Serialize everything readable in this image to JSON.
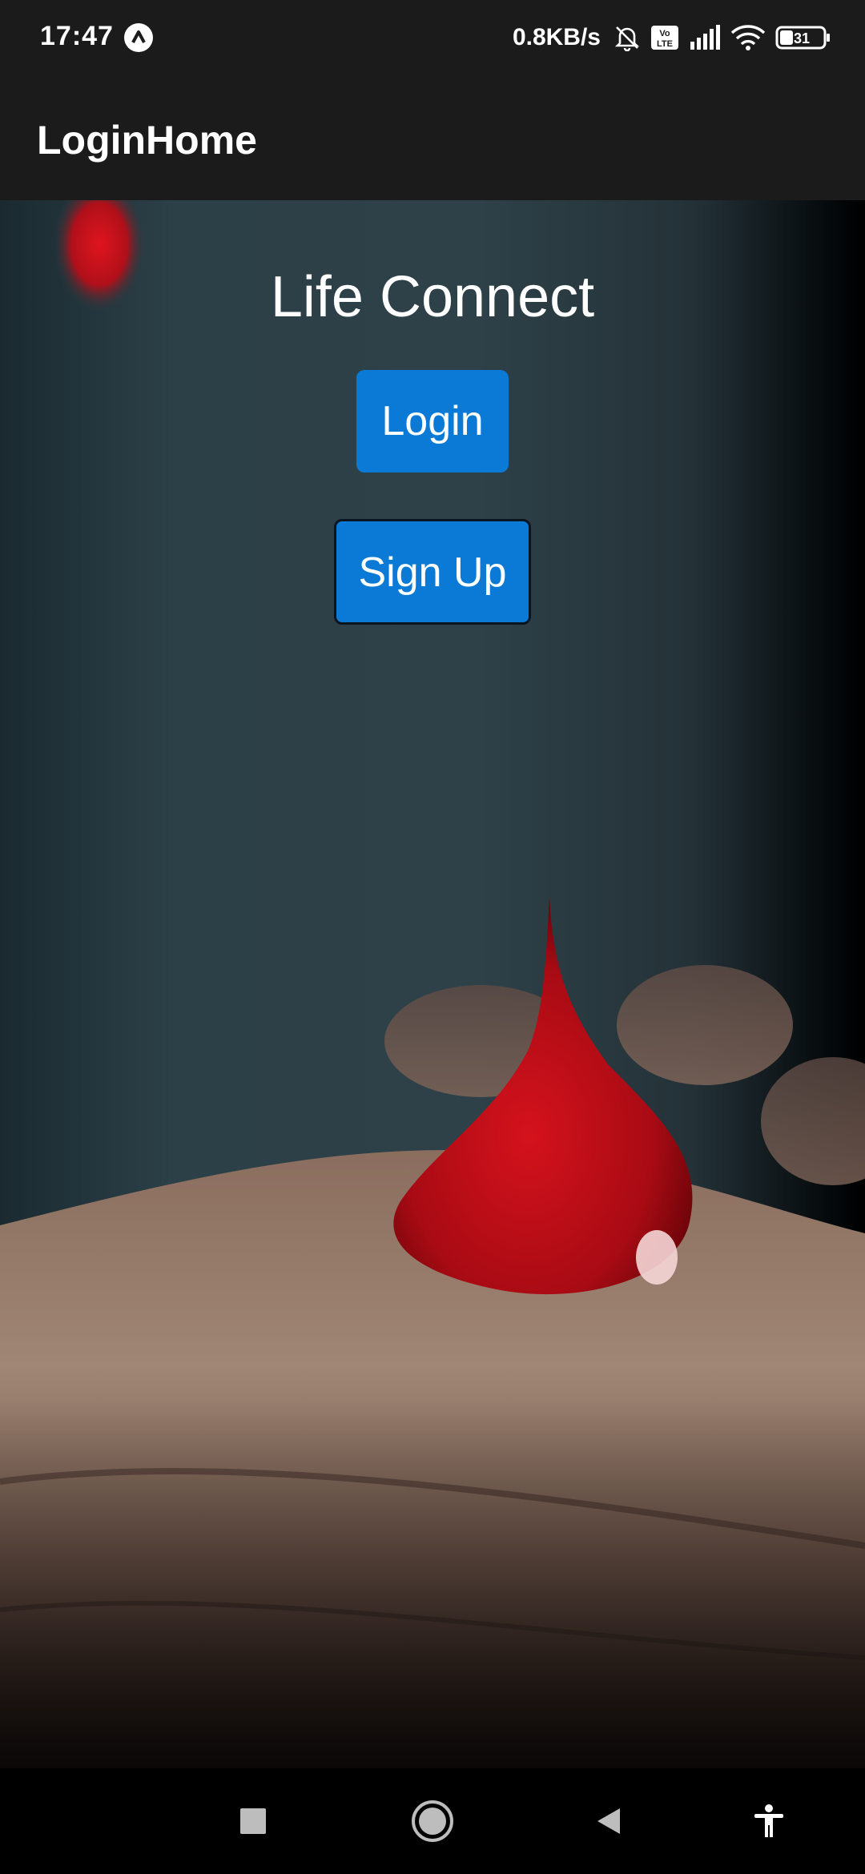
{
  "status_bar": {
    "time": "17:47",
    "network_speed": "0.8KB/s",
    "battery_level": "31",
    "icons": [
      "app-notification-icon",
      "mute-bell-icon",
      "volte-icon",
      "signal-icon",
      "wifi-icon",
      "battery-icon"
    ]
  },
  "app_bar": {
    "title": "LoginHome"
  },
  "main": {
    "headline": "Life Connect",
    "login_label": "Login",
    "signup_label": "Sign Up"
  },
  "nav_bar": {
    "icons": [
      "recents-icon",
      "home-icon",
      "back-icon",
      "accessibility-icon"
    ]
  },
  "colors": {
    "bars": "#1b1b1b",
    "button": "#0a7ad6",
    "text": "#ffffff"
  }
}
